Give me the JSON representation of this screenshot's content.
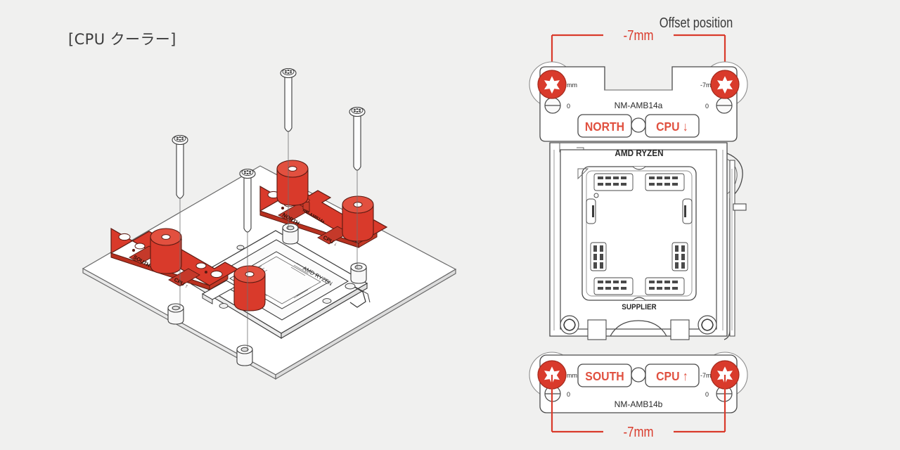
{
  "background_color": "#f0f0ef",
  "accent_red": "#d93a2b",
  "line_color": "#3b3b3b",
  "left": {
    "heading": "[CPU クーラー]",
    "view_type": "isometric-exploded-assembly",
    "socket_label_top": "AMD RYZEN",
    "brackets": [
      {
        "name": "NM-AMB14a",
        "direction_label": "NORTH",
        "cpu_label": "CPU ↓",
        "part_label": "NM-AMB14a"
      },
      {
        "name": "NM-AMB14b",
        "direction_label": "SOUTH",
        "cpu_label": "CPU ↑",
        "part_label": "NM-AMB14b"
      }
    ],
    "screw_count": 4,
    "standoff_count": 4,
    "nut_count": 4
  },
  "right": {
    "heading": "Offset position",
    "dimension_top": "-7mm",
    "dimension_bottom": "-7mm",
    "screw_offset_labels": [
      "-7mm",
      "-7mm",
      "-7mm",
      "-7mm"
    ],
    "zero_marks": [
      "0",
      "0",
      "0",
      "0"
    ],
    "top_bracket": {
      "part_number": "NM-AMB14a",
      "direction_label": "NORTH",
      "cpu_label": "CPU ↓"
    },
    "bottom_bracket": {
      "part_number": "NM-AMB14b",
      "direction_label": "SOUTH",
      "cpu_label": "CPU ↑"
    },
    "socket": {
      "top_text": "AMD RYZEN",
      "bottom_text": "SUPPLIER"
    }
  }
}
